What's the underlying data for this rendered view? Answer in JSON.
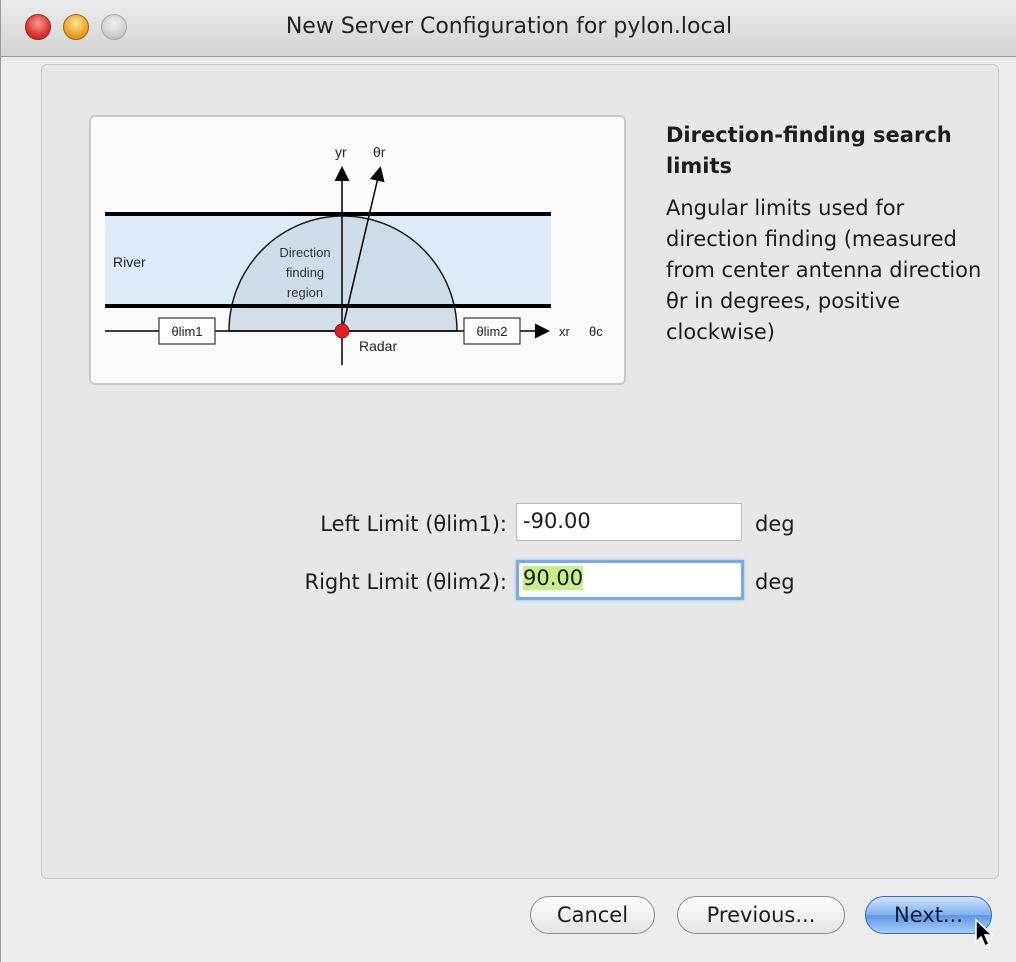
{
  "window": {
    "title": "New Server Configuration for pylon.local"
  },
  "diagram": {
    "labels": {
      "yr": "yr",
      "theta_r": "θr",
      "river": "River",
      "region_line1": "Direction",
      "region_line2": "finding",
      "region_line3": "region",
      "lim1": "θlim1",
      "lim2": "θlim2",
      "radar": "Radar",
      "xr": "xr",
      "theta_c": "θc"
    },
    "colors": {
      "river_fill": "#ddeaf8",
      "region_fill": "#cddbe9",
      "radar_dot": "#e02020"
    }
  },
  "help": {
    "title": "Direction-finding search limits",
    "body": "Angular limits used for direction finding (measured from center antenna direction θr in degrees, positive clockwise)"
  },
  "form": {
    "left": {
      "label": "Left Limit (θlim1):",
      "value": "-90.00",
      "unit": "deg"
    },
    "right": {
      "label": "Right Limit (θlim2):",
      "value": "90.00",
      "unit": "deg"
    }
  },
  "buttons": {
    "cancel": "Cancel",
    "previous": "Previous...",
    "next": "Next..."
  }
}
